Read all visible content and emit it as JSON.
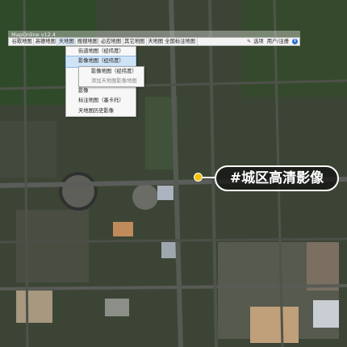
{
  "window": {
    "title": "MapOnline v12.4"
  },
  "toolbar": {
    "items": [
      "谷歌地图",
      "高德地图",
      "天地图",
      "搜搜地图",
      "必应地图",
      "其它地图",
      "天地图 全国标注地图"
    ],
    "selected_index": 2,
    "options_label": "选项",
    "login_label": "用户/注册"
  },
  "menu": {
    "items": [
      "街道地图（经纬度）",
      "影像地图（经纬度）",
      "标注",
      "街道",
      "影像",
      "标注地图（墨卡托）",
      "天地图历史影像"
    ],
    "highlighted_index": 1
  },
  "submenu": {
    "items": [
      "影像地图（经纬度）",
      "添加天地图影像地图"
    ]
  },
  "callout": {
    "text": "#城区高清影像"
  },
  "colors": {
    "marker": "#f4c20d",
    "callout_border": "#ffffff"
  }
}
